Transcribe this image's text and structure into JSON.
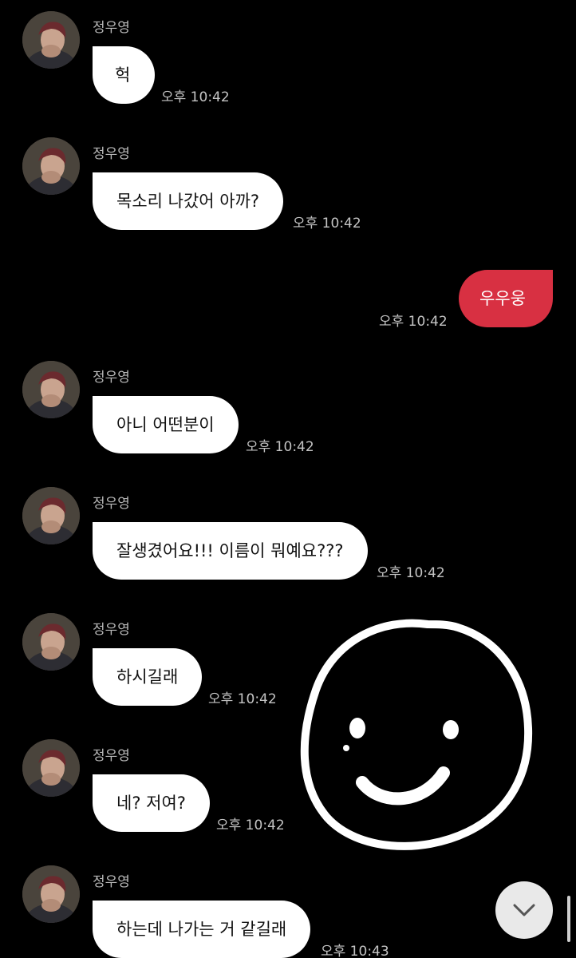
{
  "chat": {
    "messages": [
      {
        "sender": "정우영",
        "text": "헉",
        "time": "오후 10:42"
      },
      {
        "sender": "정우영",
        "text": "목소리 나갔어 아까?",
        "time": "오후 10:42"
      },
      {
        "sender": "me",
        "text": "우우웅",
        "time": "오후 10:42"
      },
      {
        "sender": "정우영",
        "text": "아니 어떤분이",
        "time": "오후 10:42"
      },
      {
        "sender": "정우영",
        "text": "잘생겼어요!!! 이름이 뭐예요???",
        "time": "오후 10:42"
      },
      {
        "sender": "정우영",
        "text": "하시길래",
        "time": "오후 10:42"
      },
      {
        "sender": "정우영",
        "text": "네? 저여?",
        "time": "오후 10:42"
      },
      {
        "sender": "정우영",
        "text": "하는데 나가는 거 같길래",
        "time": "오후 10:43"
      }
    ]
  },
  "colors": {
    "background": "#000000",
    "incoming_bubble": "#ffffff",
    "outgoing_bubble": "#d83042",
    "timestamp": "#c4c4c4"
  },
  "icons": {
    "scroll_down": "chevron-down-icon",
    "overlay": "smiley-face-doodle"
  }
}
